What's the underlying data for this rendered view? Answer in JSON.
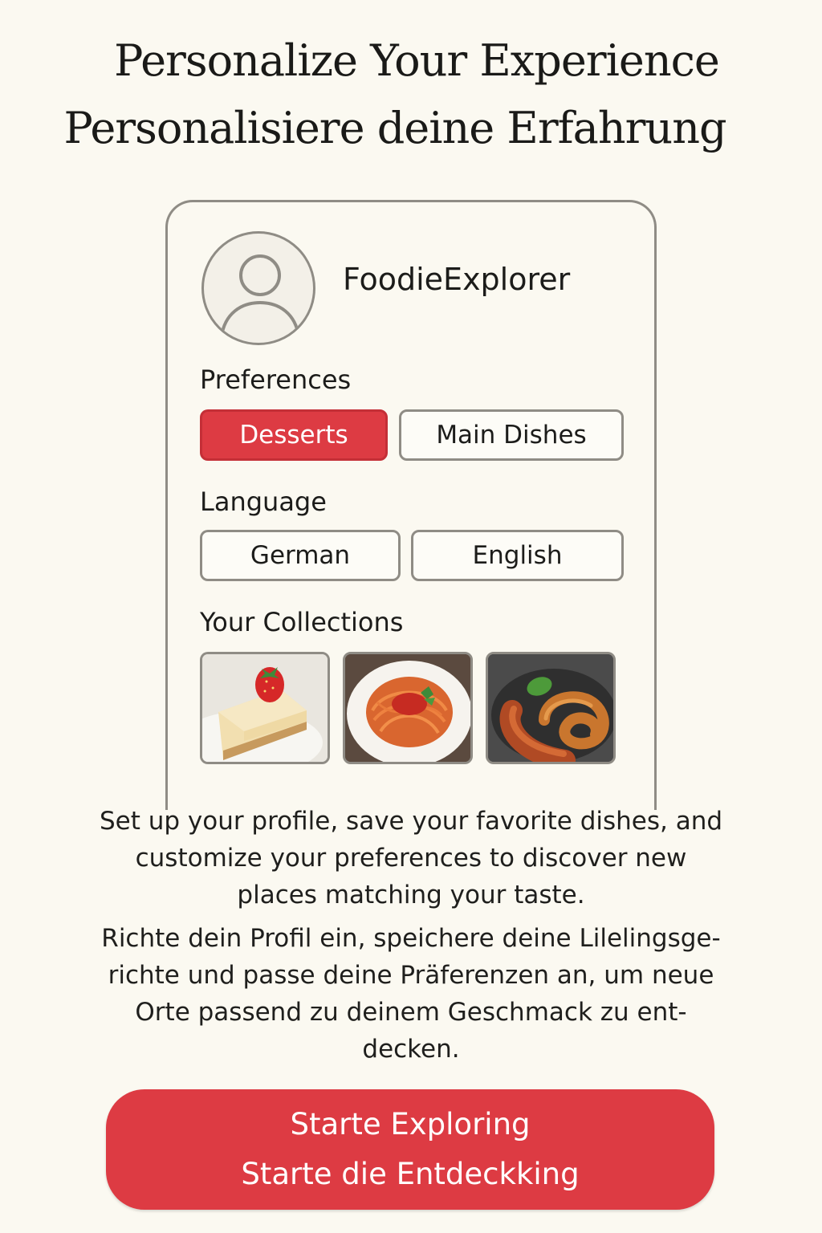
{
  "header": {
    "title_en": "Personalize Your Experience",
    "title_de": "Personalisiere deine Erfahrung"
  },
  "profile": {
    "avatar_icon": "user-avatar-icon",
    "username": "FoodieExplorer",
    "preferences_label": "Preferences",
    "preferences": [
      {
        "label": "Desserts",
        "selected": true
      },
      {
        "label": "Main Dishes",
        "selected": false
      }
    ],
    "language_label": "Language",
    "languages": [
      {
        "label": "German",
        "selected": false
      },
      {
        "label": "English",
        "selected": false
      }
    ],
    "collections_label": "Your Collections",
    "collections": [
      {
        "icon": "cheesecake-photo"
      },
      {
        "icon": "spaghetti-photo"
      },
      {
        "icon": "sausage-pretzel-photo"
      }
    ]
  },
  "description": {
    "en": [
      "Set up your profile, save your favorite dishes, and",
      "customize your preferences to discover new",
      "places matching your taste."
    ],
    "de": [
      "Richte dein Profil ein, speichere deine Lilelingsge-",
      "richte und passe deine Präferenzen an, um neue",
      "Orte passend zu deinem Geschmack zu ent-",
      "decken."
    ]
  },
  "cta": {
    "line1": "Starte Exploring",
    "line2": "Starte die Entdeckking"
  },
  "colors": {
    "accent": "#dd3b43",
    "background": "#fbf9f1",
    "border": "#8f8c85"
  }
}
